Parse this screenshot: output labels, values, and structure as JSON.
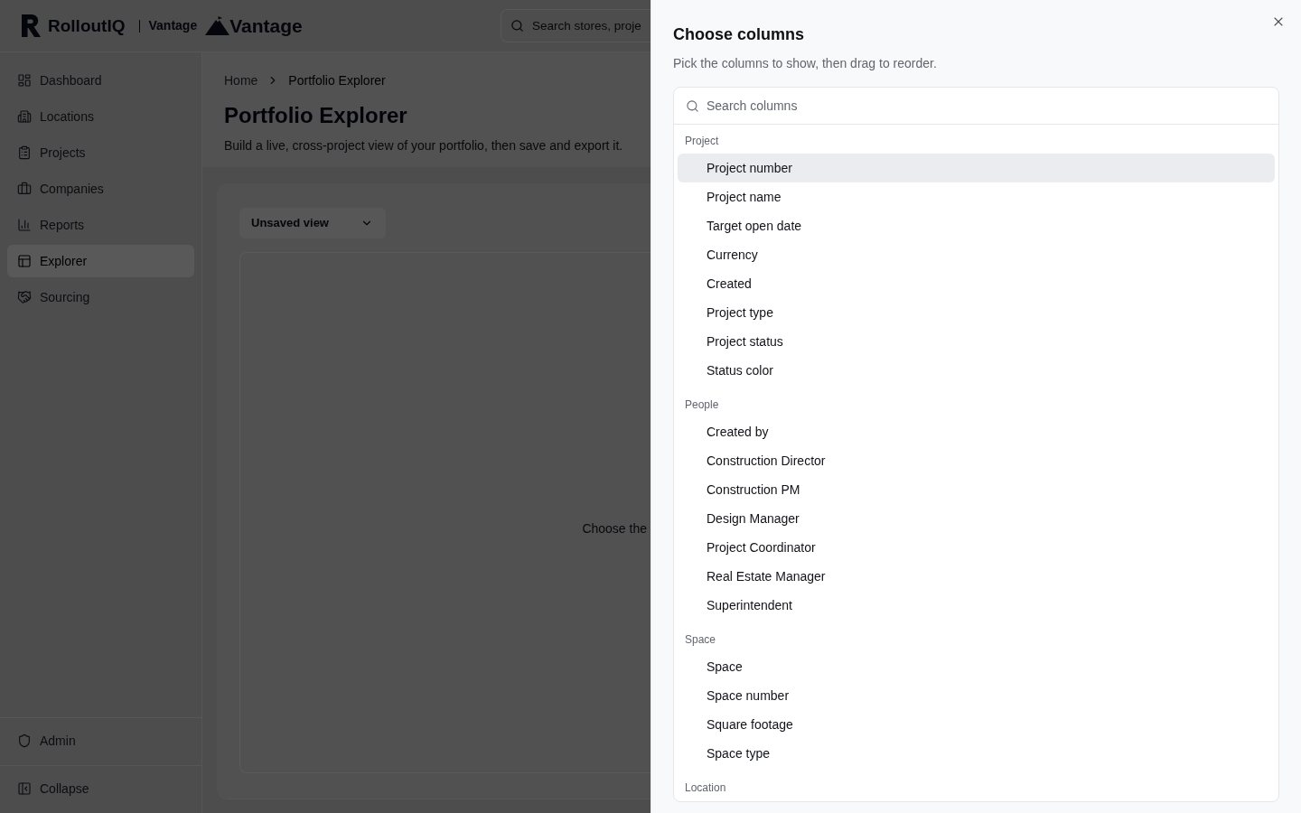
{
  "header": {
    "brand": "RolloutIQ",
    "product": "Vantage",
    "product_logo_text": "Vantage",
    "search": {
      "placeholder": "Search stores, proje"
    }
  },
  "sidebar": {
    "items": [
      {
        "label": "Dashboard",
        "selected": false
      },
      {
        "label": "Locations",
        "selected": false
      },
      {
        "label": "Projects",
        "selected": false
      },
      {
        "label": "Companies",
        "selected": false
      },
      {
        "label": "Reports",
        "selected": false
      },
      {
        "label": "Explorer",
        "selected": true
      },
      {
        "label": "Sourcing",
        "selected": false
      }
    ],
    "footer_items": [
      {
        "label": "Admin"
      },
      {
        "label": "Collapse"
      }
    ]
  },
  "breadcrumb": [
    {
      "label": "Home"
    },
    {
      "label": "Portfolio Explorer"
    }
  ],
  "page": {
    "title": "Portfolio Explorer",
    "description": "Build a live, cross-project view of your portfolio, then save and export it."
  },
  "view_select": {
    "value": "Unsaved view"
  },
  "empty_state": {
    "text": "Choose the"
  },
  "column_panel": {
    "title": "Choose columns",
    "subtitle": "Pick the columns to show, then drag to reorder.",
    "search": {
      "placeholder": "Search columns"
    },
    "groups": [
      {
        "label": "Project",
        "items": [
          {
            "label": "Project number",
            "selected": true
          },
          {
            "label": "Project name",
            "selected": false
          },
          {
            "label": "Target open date",
            "selected": false
          },
          {
            "label": "Currency",
            "selected": false
          },
          {
            "label": "Created",
            "selected": false
          },
          {
            "label": "Project type",
            "selected": false
          },
          {
            "label": "Project status",
            "selected": false
          },
          {
            "label": "Status color",
            "selected": false
          }
        ]
      },
      {
        "label": "People",
        "items": [
          {
            "label": "Created by",
            "selected": false
          },
          {
            "label": "Construction Director",
            "selected": false
          },
          {
            "label": "Construction PM",
            "selected": false
          },
          {
            "label": "Design Manager",
            "selected": false
          },
          {
            "label": "Project Coordinator",
            "selected": false
          },
          {
            "label": "Real Estate Manager",
            "selected": false
          },
          {
            "label": "Superintendent",
            "selected": false
          }
        ]
      },
      {
        "label": "Space",
        "items": [
          {
            "label": "Space",
            "selected": false
          },
          {
            "label": "Space number",
            "selected": false
          },
          {
            "label": "Square footage",
            "selected": false
          },
          {
            "label": "Space type",
            "selected": false
          }
        ]
      },
      {
        "label": "Location"
      }
    ]
  }
}
